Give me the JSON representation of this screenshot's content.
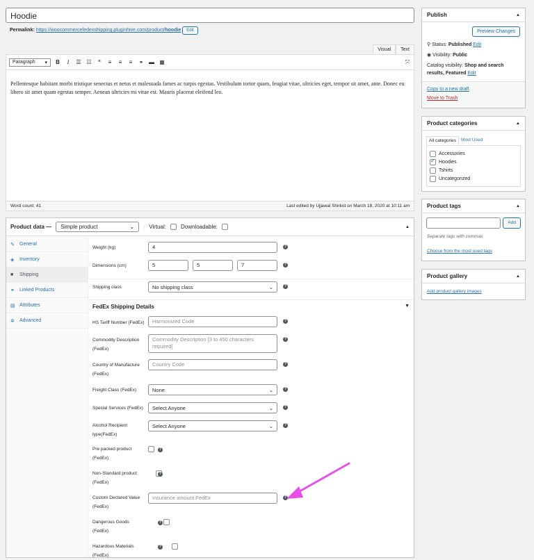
{
  "title": "Hoodie",
  "permalink": {
    "label": "Permalink:",
    "url": "https://woocommercefedexshipping.pluginhive.com/product/",
    "slug": "hoodie",
    "edit": "Edit"
  },
  "editor": {
    "tabs": [
      "Visual",
      "Text"
    ],
    "format": "Paragraph",
    "content": "Pellentesque habitant morbi tristique senectus et netus et malesuada fames ac turpis egestas. Vestibulum tortor quam, feugiat vitae, ultricies eget, tempor sit amet, ante. Donec eu libero sit amet quam egestas semper. Aenean ultricies mi vitae est. Mauris placerat eleifend leo.",
    "word_count": "Word count: 41",
    "last_edited": "Last edited by Ujjawal Shirkot on March 18, 2020 at 10:11 am"
  },
  "product_data": {
    "label": "Product data —",
    "type": "Simple product",
    "virtual": "Virtual:",
    "downloadable": "Downloadable:",
    "tabs": [
      "General",
      "Inventory",
      "Shipping",
      "Linked Products",
      "Attributes",
      "Advanced"
    ],
    "weight": {
      "label": "Weight (kg)",
      "value": "4"
    },
    "dimensions": {
      "label": "Dimensions (cm)",
      "length": "5",
      "width": "5",
      "height": "7"
    },
    "shipping_class": {
      "label": "Shipping class",
      "value": "No shipping class"
    },
    "fedex": {
      "title": "FedEx Shipping Details",
      "hs_tariff": {
        "label": "HS Tariff Number (FedEx)",
        "placeholder": "Harmonized Code"
      },
      "commodity": {
        "label1": "Commodity Description",
        "label2": "(FedEx)",
        "placeholder": "Commodity Description [3 to 450 characters required]"
      },
      "country": {
        "label1": "Country of Manufacture",
        "label2": "(FedEx)",
        "placeholder": "Country Code"
      },
      "freight": {
        "label": "Freight Class (FedEx)",
        "value": "None"
      },
      "special": {
        "label": "Special Services (FedEx)",
        "value": "Select Anyone"
      },
      "alcohol": {
        "label1": "Alcohol Recipient",
        "label2": "type(FedEx)",
        "value": "Select Anyone"
      },
      "prepacked": {
        "label1": "Pre packed product",
        "label2": "(FedEx)"
      },
      "nonstandard": {
        "label1": "Non-Standard product",
        "label2": "(FedEx)"
      },
      "custom_declared": {
        "label1": "Custom Declared Value",
        "label2": "(FedEx)",
        "placeholder": "Insurance amount FedEx"
      },
      "dangerous": {
        "label1": "Dangerous Goods",
        "label2": "(FedEx)"
      },
      "hazardous": {
        "label1": "Hazardous Materials",
        "label2": "(FedEx)"
      }
    }
  },
  "publish": {
    "title": "Publish",
    "preview": "Preview Changes",
    "status_label": "Status:",
    "status": "Published",
    "visibility_label": "Visibility:",
    "visibility": "Public",
    "catalog_label": "Catalog visibility:",
    "catalog": "Shop and search results, Featured",
    "edit": "Edit",
    "copy": "Copy to a new draft",
    "trash": "Move to Trash"
  },
  "categories": {
    "title": "Product categories",
    "tab_all": "All categories",
    "tab_used": "Most Used",
    "items": [
      {
        "label": "Accessories",
        "checked": false
      },
      {
        "label": "Hoodies",
        "checked": true
      },
      {
        "label": "Tshirts",
        "checked": false
      },
      {
        "label": "Uncategorized",
        "checked": false
      }
    ]
  },
  "tags": {
    "title": "Product tags",
    "add": "Add",
    "hint": "Separate tags with commas",
    "choose": "Choose from the most used tags"
  },
  "gallery": {
    "title": "Product gallery",
    "add": "Add product gallery images"
  },
  "colors": {
    "accent": "#2271b1",
    "arrow": "#e84ee8",
    "trash": "#b32d2e"
  }
}
